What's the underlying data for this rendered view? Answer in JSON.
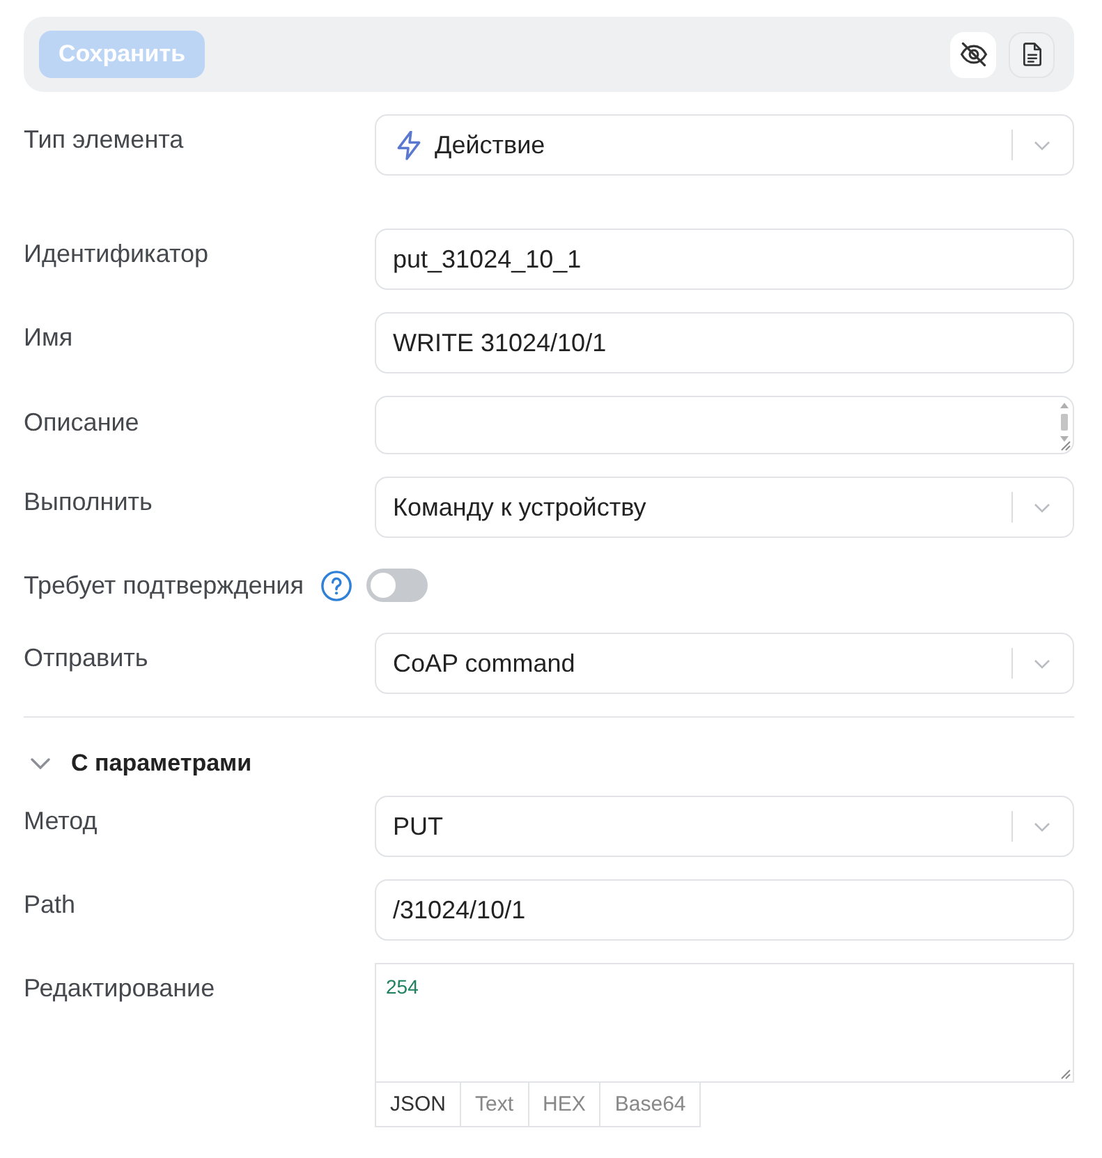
{
  "toolbar": {
    "save_button": {
      "label": "Сохранить",
      "disabled": true
    },
    "icon_buttons": [
      {
        "kind": "hide",
        "selected": true
      },
      {
        "kind": "document",
        "selected": false
      }
    ]
  },
  "element_type": {
    "kind": "select",
    "label": "Тип элемента",
    "value": "Действие",
    "with_icon": true
  },
  "fields": [
    {
      "kind": "text",
      "label": "Идентификатор",
      "value": "put_31024_10_1"
    },
    {
      "kind": "text",
      "label": "Имя",
      "value": "WRITE 31024/10/1"
    },
    {
      "kind": "textarea",
      "label": "Описание"
    },
    {
      "kind": "select",
      "label": "Выполнить",
      "value": "Команду к устройству"
    },
    {
      "kind": "toggle",
      "label": "Требует подтверждения",
      "help": true,
      "on": false
    },
    {
      "kind": "select",
      "label": "Отправить",
      "value": "CoAP command"
    }
  ],
  "parameters": {
    "title": "С параметрами",
    "expanded": true,
    "fields": [
      {
        "kind": "select",
        "label": "Метод",
        "value": "PUT"
      },
      {
        "kind": "text",
        "label": "Path",
        "value": "/31024/10/1"
      },
      {
        "kind": "editor",
        "label": "Редактирование",
        "value": "254",
        "formats": [
          {
            "label": "JSON",
            "selected": true
          },
          {
            "label": "Text",
            "selected": false
          },
          {
            "label": "HEX",
            "selected": false
          },
          {
            "label": "Base64",
            "selected": false
          }
        ]
      }
    ]
  }
}
